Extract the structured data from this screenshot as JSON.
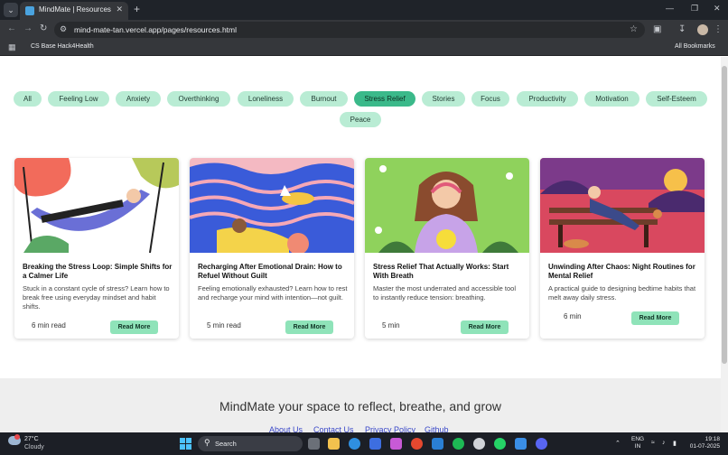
{
  "browser": {
    "tab_title": "MindMate | Resources",
    "url": "mind-mate-tan.vercel.app/pages/resources.html",
    "bookmark": "CS Base Hack4Health",
    "all_bookmarks": "All Bookmarks"
  },
  "filters": [
    {
      "label": "All"
    },
    {
      "label": "Feeling Low"
    },
    {
      "label": "Anxiety"
    },
    {
      "label": "Overthinking"
    },
    {
      "label": "Loneliness"
    },
    {
      "label": "Burnout"
    },
    {
      "label": "Stress Relief"
    },
    {
      "label": "Stories"
    },
    {
      "label": "Focus"
    },
    {
      "label": "Productivity"
    },
    {
      "label": "Motivation"
    },
    {
      "label": "Self-Esteem"
    },
    {
      "label": "Peace"
    }
  ],
  "active_filter": "Stress Relief",
  "cards": [
    {
      "title": "Breaking the Stress Loop: Simple Shifts for a Calmer Life",
      "description": "Stuck in a constant cycle of stress? Learn how to break free using everyday mindset and habit shifts.",
      "read_time": "6 min read",
      "button": "Read More"
    },
    {
      "title": "Recharging After Emotional Drain: How to Refuel Without Guilt",
      "description": "Feeling emotionally exhausted? Learn how to rest and recharge your mind with intention—not guilt.",
      "read_time": "5 min read",
      "button": "Read More"
    },
    {
      "title": "Stress Relief That Actually Works: Start With Breath",
      "description": "Master the most underrated and accessible tool to instantly reduce tension: breathing.",
      "read_time": "5 min",
      "button": "Read More"
    },
    {
      "title": "Unwinding After Chaos: Night Routines for Mental Relief",
      "description": "A practical guide to designing bedtime habits that melt away daily stress.",
      "read_time": "6 min",
      "button": "Read More"
    }
  ],
  "footer": {
    "tagline": "MindMate your space to reflect, breathe, and grow",
    "links": [
      "About Us",
      "Contact Us",
      "Privacy Policy",
      "Github"
    ]
  },
  "taskbar": {
    "temperature": "27°C",
    "condition": "Cloudy",
    "weather_badge": "1",
    "search_label": "Search",
    "lang_line1": "ENG",
    "lang_line2": "IN",
    "time": "19:18",
    "date": "01-07-2025"
  },
  "colors": {
    "pill": "#b9ecd4",
    "pill_active": "#3bb98a",
    "button": "#8fe3b9",
    "link": "#3a48c8"
  }
}
